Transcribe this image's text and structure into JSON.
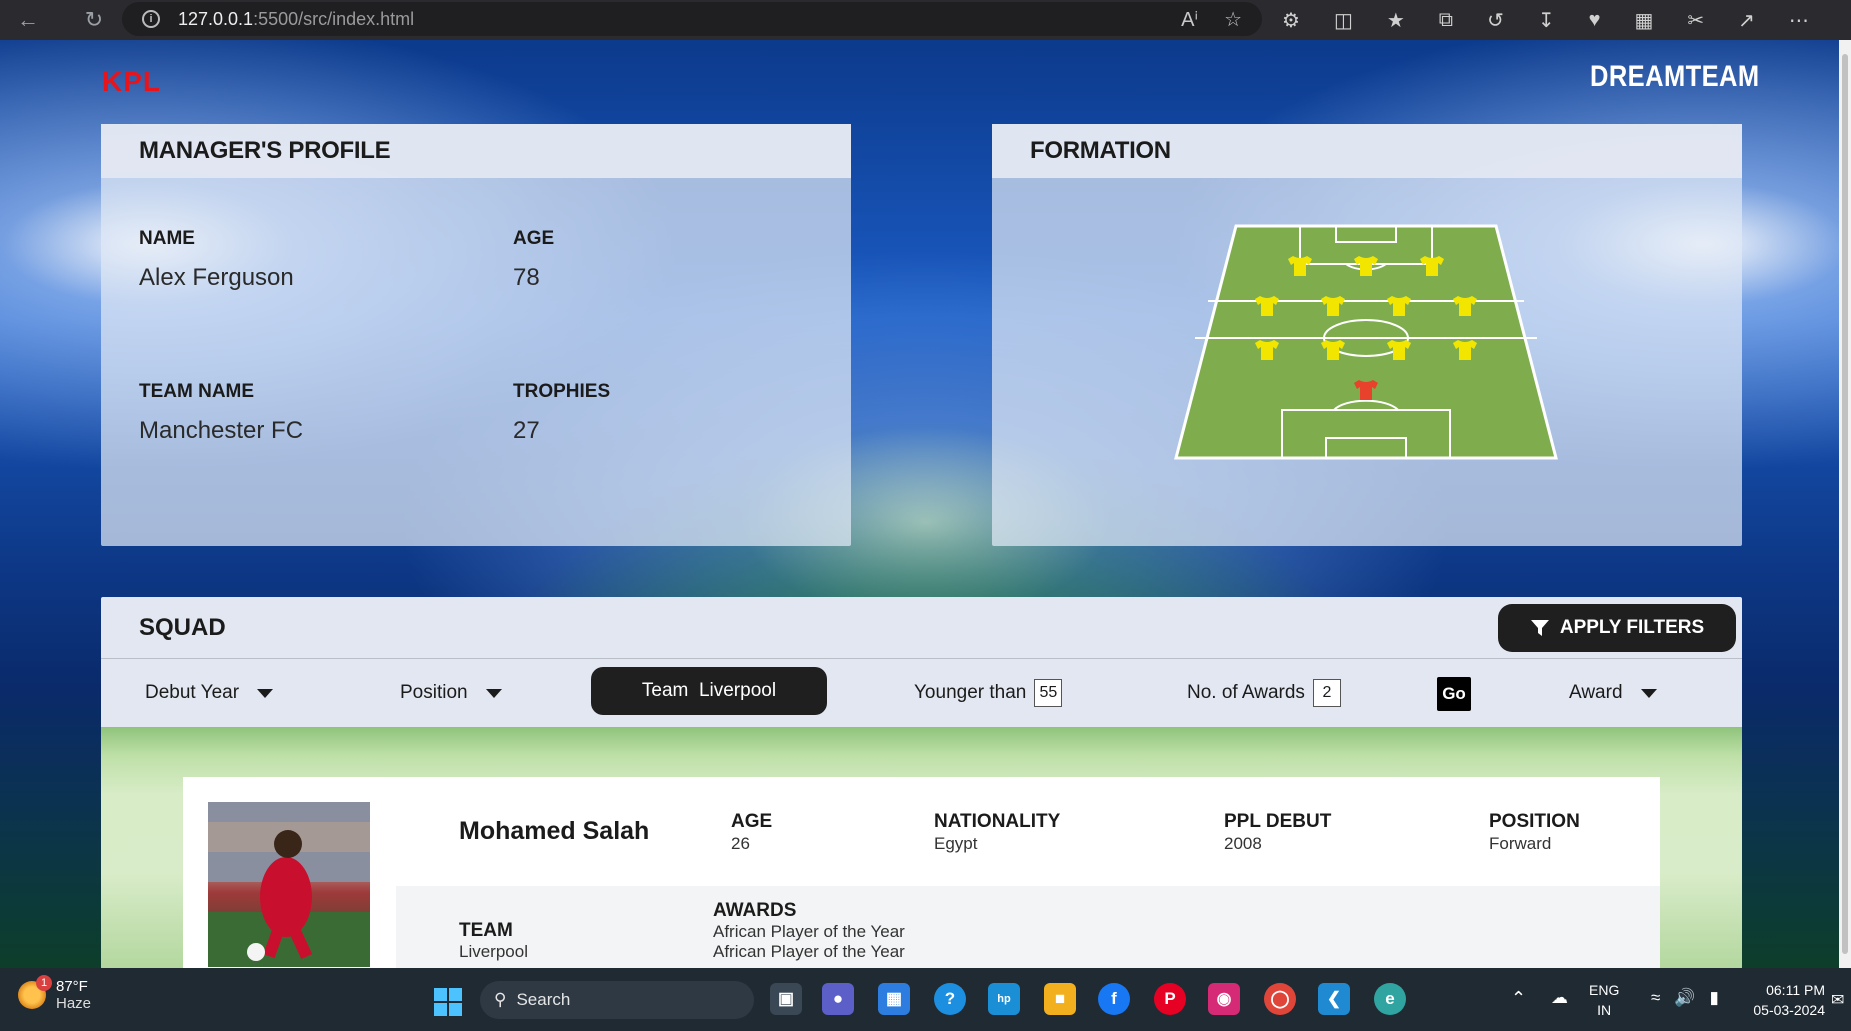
{
  "browser": {
    "url_host": "127.0.0.1",
    "url_path": ":5500/src/index.html"
  },
  "page": {
    "brand_left": "KPL",
    "brand_right": "DREAMTEAM"
  },
  "profile": {
    "title": "MANAGER'S PROFILE",
    "name_label": "NAME",
    "name_value": "Alex Ferguson",
    "age_label": "AGE",
    "age_value": "78",
    "team_label": "TEAM NAME",
    "team_value": "Manchester FC",
    "trophies_label": "TROPHIES",
    "trophies_value": "27"
  },
  "formation": {
    "title": "FORMATION",
    "rows": [
      3,
      4,
      4,
      1
    ],
    "outfield_color": "#f2e600",
    "keeper_color": "#e8412c",
    "pitch_color": "#7fad4d"
  },
  "squad": {
    "title": "SQUAD",
    "apply_label": "APPLY FILTERS",
    "filters": {
      "debut_year": "Debut Year",
      "position": "Position",
      "team_prefix": "Team",
      "team_value": "Liverpool",
      "younger_label": "Younger than",
      "younger_value": "55",
      "awards_label": "No. of Awards",
      "awards_value": "2",
      "go_label": "Go",
      "award": "Award"
    },
    "player": {
      "name": "Mohamed Salah",
      "age_label": "AGE",
      "age_value": "26",
      "nationality_label": "NATIONALITY",
      "nationality_value": "Egypt",
      "debut_label": "PPL DEBUT",
      "debut_value": "2008",
      "position_label": "POSITION",
      "position_value": "Forward",
      "team_label": "TEAM",
      "team_value": "Liverpool",
      "awards_label": "AWARDS",
      "awards": [
        "African Player of the Year",
        "African Player of the Year"
      ]
    }
  },
  "taskbar": {
    "temp": "87°F",
    "weather": "Haze",
    "weather_badge": "1",
    "search_placeholder": "Search",
    "lang_line1": "ENG",
    "lang_line2": "IN",
    "time": "06:11 PM",
    "date": "05-03-2024"
  }
}
